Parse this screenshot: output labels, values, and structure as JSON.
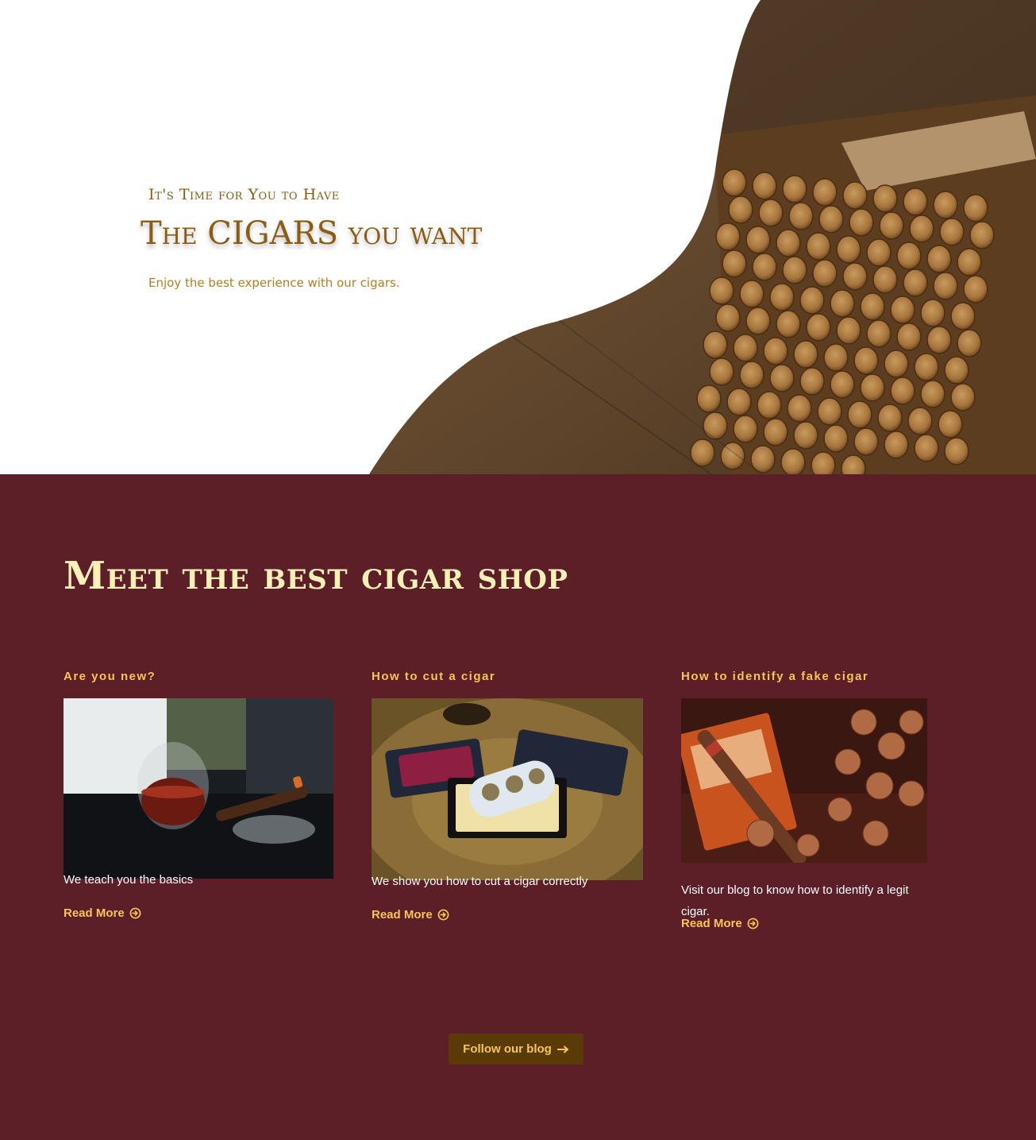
{
  "hero": {
    "eyebrow": "It's Time for You to Have",
    "title": "The CIGARS you want",
    "subtitle": "Enjoy the best experience with our cigars.",
    "image": "cigar-bundle-photo"
  },
  "shop": {
    "title": "Meet the best cigar shop",
    "cards": [
      {
        "title": "Are you new?",
        "image": "whisky-glass-and-cigar-photo",
        "text": "We teach you the basics",
        "link_label": "Read More",
        "link_icon": "arrow-circle-right-icon"
      },
      {
        "title": "How to cut a cigar",
        "image": "cigar-cutters-on-wood-photo",
        "text": "We show you how to cut a cigar correctly",
        "link_label": "Read More",
        "link_icon": "arrow-circle-right-icon"
      },
      {
        "title": "How to identify a fake cigar",
        "image": "cigar-box-and-hazelnuts-photo",
        "text": "Visit our blog to know how to identify a legit cigar.",
        "link_label": "Read More",
        "link_icon": "arrow-circle-right-icon"
      }
    ],
    "follow_button": {
      "label": "Follow our blog",
      "icon": "long-arrow-right-icon"
    }
  },
  "colors": {
    "hero_text": "#8a5d12",
    "shop_bg": "#5c1f28",
    "shop_title": "#fbf0b5",
    "accent": "#f6c553",
    "button_bg": "#5a3b08"
  }
}
